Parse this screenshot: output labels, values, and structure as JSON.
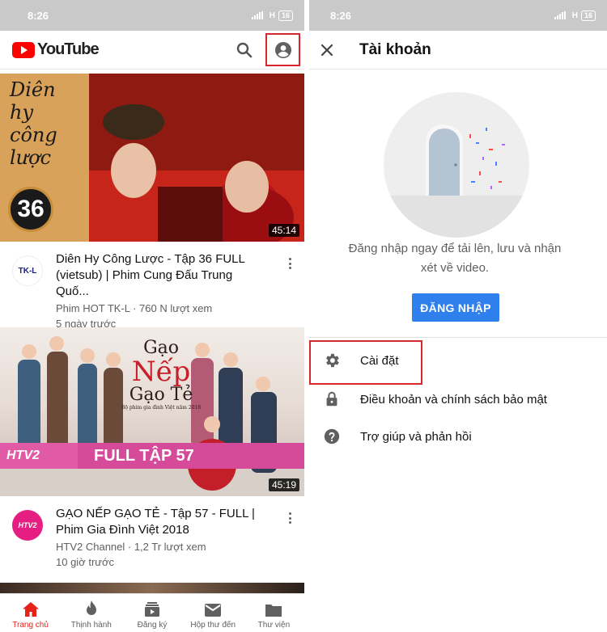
{
  "left": {
    "status": {
      "time": "8:26",
      "network": "H",
      "battery": "16"
    },
    "app": {
      "logo_text": "YouTube"
    },
    "videos": [
      {
        "thumb_text_line1": "Diên",
        "thumb_text_line2": "hy",
        "thumb_text_line3": "công",
        "thumb_text_line4": "lược",
        "thumb_badge": "36",
        "duration": "45:14",
        "channel_avatar_text": "TK-L",
        "title": "Diên Hy Công Lược - Tập 36 FULL (vietsub) | Phim Cung Đấu Trung Quố...",
        "meta_line1": "Phim HOT TK-L · 760 N lượt xem",
        "meta_line2": "5 ngày trước"
      },
      {
        "thumb_title_a": "Gạo",
        "thumb_title_b": "Nếp",
        "thumb_title_c": "Gạo Tẻ",
        "thumb_sub": "Bộ phim gia đình Việt năm 2018",
        "thumb_banner_logo": "HTV2",
        "thumb_banner": "FULL TẬP 57",
        "duration": "45:19",
        "channel_avatar_text": "HTV2",
        "title": "GẠO NẾP GẠO TẺ - Tập 57 - FULL | Phim Gia Đình Việt 2018",
        "meta_line1": "HTV2 Channel · 1,2 Tr lượt xem",
        "meta_line2": "10 giờ trước"
      }
    ],
    "nav": [
      {
        "label": "Trang chủ",
        "icon": "home-icon"
      },
      {
        "label": "Thịnh hành",
        "icon": "trending-icon"
      },
      {
        "label": "Đăng ký",
        "icon": "subscriptions-icon"
      },
      {
        "label": "Hộp thư đến",
        "icon": "inbox-icon"
      },
      {
        "label": "Thư viện",
        "icon": "library-icon"
      }
    ]
  },
  "right": {
    "status": {
      "time": "8:26",
      "network": "H",
      "battery": "16"
    },
    "title": "Tài khoản",
    "signin_text_line1": "Đăng nhập ngay để tải lên, lưu và nhận",
    "signin_text_line2": "xét về video.",
    "signin_button": "ĐĂNG NHẬP",
    "menu": [
      {
        "label": "Cài đặt",
        "icon": "gear-icon"
      },
      {
        "label": "Điều khoản và chính sách bảo mật",
        "icon": "lock-icon"
      },
      {
        "label": "Trợ giúp và phản hồi",
        "icon": "help-icon"
      }
    ]
  },
  "colors": {
    "brand_red": "#ff0000",
    "highlight_box": "#d9262c",
    "signin_blue": "#2f80ed",
    "status_bar": "#c9c9c9"
  }
}
